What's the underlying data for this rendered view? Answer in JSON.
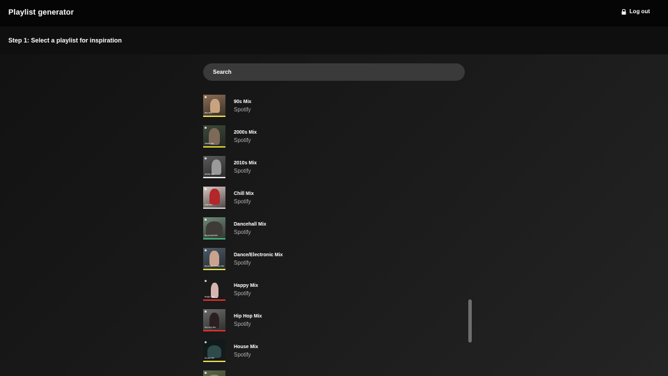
{
  "app": {
    "title": "Playlist generator",
    "logout_label": "Log out"
  },
  "step": {
    "title": "Step 1: Select a playlist for inspiration"
  },
  "search": {
    "placeholder": "Search"
  },
  "playlists": [
    {
      "name": "90s Mix",
      "owner": "Spotify",
      "thumb_caption": "90s Mix",
      "strip_color": "#e6d64a",
      "bg": "#8a6d55",
      "figure": "#c9a37f"
    },
    {
      "name": "2000s Mix",
      "owner": "Spotify",
      "thumb_caption": "2000s Mix",
      "strip_color": "#d8cf3a",
      "bg": "#3d4a3a",
      "figure": "#7d6a58"
    },
    {
      "name": "2010s Mix",
      "owner": "Spotify",
      "thumb_caption": "2010s Mix",
      "strip_color": "#e0e0e0",
      "bg": "#5a5a5a",
      "figure": "#9a9a9a"
    },
    {
      "name": "Chill Mix",
      "owner": "Spotify",
      "thumb_caption": "Chill Mix",
      "strip_color": "#c9c9c9",
      "bg": "#d9c7bf",
      "figure": "#b3262a"
    },
    {
      "name": "Dancehall Mix",
      "owner": "Spotify",
      "thumb_caption": "Dancehall Mix",
      "strip_color": "#3fb37a",
      "bg": "#6f8a78",
      "figure": "#3e3a36"
    },
    {
      "name": "Dance/Electronic Mix",
      "owner": "Spotify",
      "thumb_caption": "Dance/Electronic Mix",
      "strip_color": "#d9d94a",
      "bg": "#4b5a66",
      "figure": "#c9a38d"
    },
    {
      "name": "Happy Mix",
      "owner": "Spotify",
      "thumb_caption": "Happy Mix",
      "strip_color": "#e0302a",
      "bg": "#1a1a1a",
      "figure": "#d6b4b0"
    },
    {
      "name": "Hip Hop Mix",
      "owner": "Spotify",
      "thumb_caption": "Hip Hop Mix",
      "strip_color": "#e0302a",
      "bg": "#6a6a6a",
      "figure": "#2a2020"
    },
    {
      "name": "House Mix",
      "owner": "Spotify",
      "thumb_caption": "House Mix",
      "strip_color": "#e6d64a",
      "bg": "#0e1a1c",
      "figure": "#2f4a4a"
    },
    {
      "name": "",
      "owner": "",
      "thumb_caption": "",
      "strip_color": "#9aa24a",
      "bg": "#5e6a4a",
      "figure": "#8a8a6a"
    }
  ],
  "icons": {
    "logout": "lock-icon"
  },
  "colors": {
    "topbar": "#050505",
    "search_bg": "#3a3a3a",
    "secondary_text": "#b3b3b3"
  }
}
